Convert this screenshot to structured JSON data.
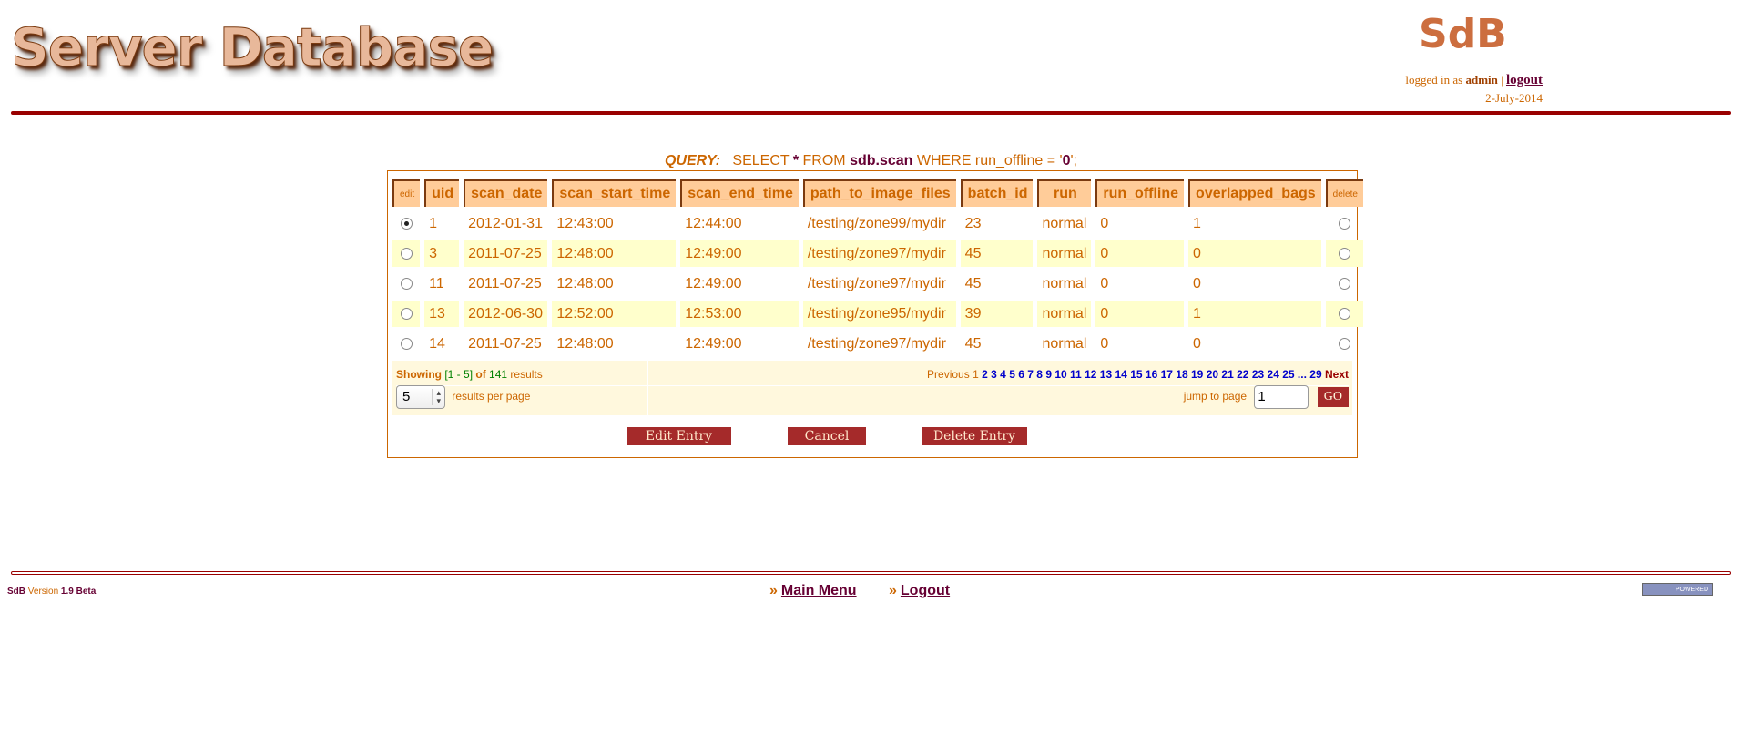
{
  "header": {
    "title": "Server Database",
    "logo_text": "SdB",
    "logged_in_prefix": "logged in as",
    "user": "admin",
    "separator": "|",
    "logout": "logout",
    "date": "2-July-2014"
  },
  "query": {
    "label": "QUERY:",
    "select": "SELECT",
    "star": "*",
    "from": "FROM",
    "table": "sdb.scan",
    "where": "WHERE run_offline = '",
    "value": "0",
    "end": "';"
  },
  "table": {
    "columns": [
      "edit",
      "uid",
      "scan_date",
      "scan_start_time",
      "scan_end_time",
      "path_to_image_files",
      "batch_id",
      "run",
      "run_offline",
      "overlapped_bags",
      "delete"
    ],
    "rows": [
      {
        "selected": true,
        "uid": "1",
        "scan_date": "2012-01-31",
        "start": "12:43:00",
        "end": "12:44:00",
        "path": "/testing/zone99/mydir",
        "batch": "23",
        "run": "normal",
        "offline": "0",
        "bags": "1"
      },
      {
        "selected": false,
        "uid": "3",
        "scan_date": "2011-07-25",
        "start": "12:48:00",
        "end": "12:49:00",
        "path": "/testing/zone97/mydir",
        "batch": "45",
        "run": "normal",
        "offline": "0",
        "bags": "0"
      },
      {
        "selected": false,
        "uid": "11",
        "scan_date": "2011-07-25",
        "start": "12:48:00",
        "end": "12:49:00",
        "path": "/testing/zone97/mydir",
        "batch": "45",
        "run": "normal",
        "offline": "0",
        "bags": "0"
      },
      {
        "selected": false,
        "uid": "13",
        "scan_date": "2012-06-30",
        "start": "12:52:00",
        "end": "12:53:00",
        "path": "/testing/zone95/mydir",
        "batch": "39",
        "run": "normal",
        "offline": "0",
        "bags": "1"
      },
      {
        "selected": false,
        "uid": "14",
        "scan_date": "2011-07-25",
        "start": "12:48:00",
        "end": "12:49:00",
        "path": "/testing/zone97/mydir",
        "batch": "45",
        "run": "normal",
        "offline": "0",
        "bags": "0"
      }
    ]
  },
  "pagination": {
    "showing": "Showing",
    "range": "[1 - 5]",
    "of": "of",
    "total": "141",
    "results": "results",
    "previous": "Previous",
    "current": "1",
    "pages": [
      "2",
      "3",
      "4",
      "5",
      "6",
      "7",
      "8",
      "9",
      "10",
      "11",
      "12",
      "13",
      "14",
      "15",
      "16",
      "17",
      "18",
      "19",
      "20",
      "21",
      "22",
      "23",
      "24",
      "25",
      "...",
      "29"
    ],
    "next": "Next",
    "per_page_value": "5",
    "per_page_label": "results per page",
    "jump_label": "jump to page",
    "jump_value": "1",
    "go": "GO"
  },
  "buttons": {
    "edit": "Edit Entry",
    "cancel": "Cancel",
    "delete": "Delete Entry"
  },
  "footer": {
    "app": "SdB",
    "version_label": "Version",
    "version": "1.9 Beta",
    "main_menu": "Main Menu",
    "logout": "Logout",
    "arrow": "»",
    "php_badge": "POWERED"
  }
}
